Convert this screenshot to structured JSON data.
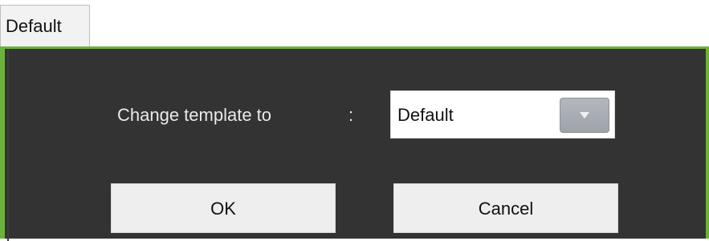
{
  "tab": {
    "label": "Default"
  },
  "dialog": {
    "label": "Change template to",
    "separator": ":",
    "select": {
      "value": "Default"
    },
    "buttons": {
      "ok": "OK",
      "cancel": "Cancel"
    }
  },
  "colors": {
    "accent_border": "#6cb33e",
    "panel_bg": "#333333"
  }
}
